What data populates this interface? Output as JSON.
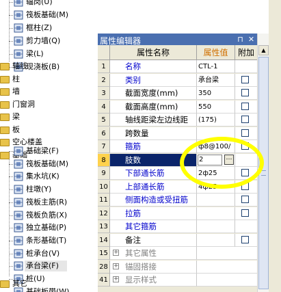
{
  "tree": {
    "items": [
      {
        "label": "辐岗(U)",
        "icon": "wall-icon",
        "level": 2
      },
      {
        "label": "筏板基础(M)",
        "icon": "raft-foundation-icon",
        "level": 2
      },
      {
        "label": "框柱(Z)",
        "icon": "frame-column-icon",
        "level": 2
      },
      {
        "label": "剪力墙(Q)",
        "icon": "shear-wall-icon",
        "level": 2
      },
      {
        "label": "梁(L)",
        "icon": "beam-icon",
        "level": 2
      },
      {
        "label": "现浇板(B)",
        "icon": "slab-icon",
        "level": 2
      },
      {
        "label": "轴线",
        "icon": "folder-icon",
        "level": 1
      },
      {
        "label": "柱",
        "icon": "folder-icon",
        "level": 1
      },
      {
        "label": "墙",
        "icon": "folder-icon",
        "level": 1
      },
      {
        "label": "门窗洞",
        "icon": "folder-icon",
        "level": 1
      },
      {
        "label": "梁",
        "icon": "folder-icon",
        "level": 1
      },
      {
        "label": "板",
        "icon": "folder-icon",
        "level": 1
      },
      {
        "label": "空心楼盖",
        "icon": "folder-icon",
        "level": 1
      },
      {
        "label": "基础",
        "icon": "folder-icon",
        "level": 1
      },
      {
        "label": "基础梁(F)",
        "icon": "foundation-beam-icon",
        "level": 2
      },
      {
        "label": "筏板基础(M)",
        "icon": "raft-foundation-icon",
        "level": 2
      },
      {
        "label": "集水坑(K)",
        "icon": "sump-pit-icon",
        "level": 2
      },
      {
        "label": "柱墩(Y)",
        "icon": "column-pier-icon",
        "level": 2
      },
      {
        "label": "筏板主筋(R)",
        "icon": "raft-main-rebar-icon",
        "level": 2
      },
      {
        "label": "筏板负筋(X)",
        "icon": "raft-negative-rebar-icon",
        "level": 2
      },
      {
        "label": "独立基础(P)",
        "icon": "isolated-footing-icon",
        "level": 2
      },
      {
        "label": "条形基础(T)",
        "icon": "strip-footing-icon",
        "level": 2
      },
      {
        "label": "桩承台(V)",
        "icon": "pile-cap-icon",
        "level": 2
      },
      {
        "label": "承台梁(F)",
        "icon": "pile-cap-beam-icon",
        "level": 2,
        "selected": true
      },
      {
        "label": "桩(U)",
        "icon": "pile-icon",
        "level": 2
      },
      {
        "label": "基础板带(W)",
        "icon": "foundation-strip-icon",
        "level": 2
      },
      {
        "label": "其它",
        "icon": "folder-icon",
        "level": 1
      }
    ]
  },
  "panel": {
    "title": "属性编辑器",
    "pin_icon": "pin-icon",
    "close_icon": "close-icon",
    "headers": {
      "name": "属性名称",
      "value": "属性值",
      "extra": "附加"
    },
    "rows": [
      {
        "num": "1",
        "name": "名称",
        "value": "CTL-1",
        "blue": true,
        "check": false
      },
      {
        "num": "2",
        "name": "类别",
        "value": "承台梁",
        "blue": true,
        "check": true
      },
      {
        "num": "3",
        "name": "截面宽度(mm)",
        "value": "350",
        "blue": false,
        "check": true
      },
      {
        "num": "4",
        "name": "截面高度(mm)",
        "value": "550",
        "blue": false,
        "check": true
      },
      {
        "num": "5",
        "name": "轴线距梁左边线距",
        "value": "(175)",
        "blue": false,
        "check": true
      },
      {
        "num": "6",
        "name": "跨数量",
        "value": "",
        "blue": false,
        "check": true
      },
      {
        "num": "7",
        "name": "箍筋",
        "value": "ф8@100/",
        "blue": true,
        "check": true
      },
      {
        "num": "8",
        "name": "肢数",
        "value": "2",
        "blue": true,
        "check": false,
        "selected": true
      },
      {
        "num": "9",
        "name": "下部通长筋",
        "value": "2ф25",
        "blue": true,
        "check": true
      },
      {
        "num": "10",
        "name": "上部通长筋",
        "value": "4ф25",
        "blue": true,
        "check": true
      },
      {
        "num": "11",
        "name": "侧面构造或受扭筋",
        "value": "",
        "blue": true,
        "check": true
      },
      {
        "num": "12",
        "name": "拉筋",
        "value": "",
        "blue": true,
        "check": true
      },
      {
        "num": "13",
        "name": "其它箍筋",
        "value": "",
        "blue": true,
        "check": false
      },
      {
        "num": "14",
        "name": "备注",
        "value": "",
        "blue": false,
        "check": true
      },
      {
        "num": "15",
        "name": "其它属性",
        "value": "",
        "group": true
      },
      {
        "num": "28",
        "name": "锚固搭接",
        "value": "",
        "group": true
      },
      {
        "num": "41",
        "name": "显示样式",
        "value": "",
        "group": true
      }
    ],
    "ellipsis_label": "…"
  }
}
